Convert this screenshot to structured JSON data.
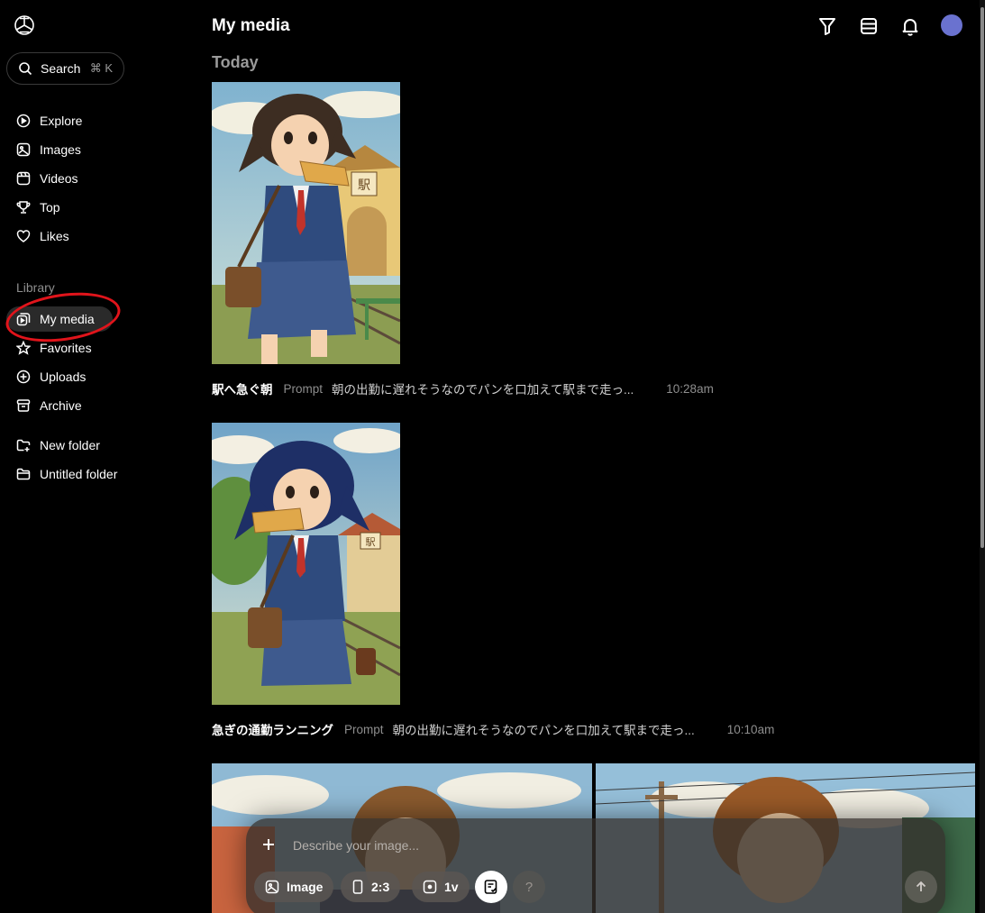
{
  "sidebar": {
    "search": {
      "label": "Search",
      "shortcut": "⌘ K"
    },
    "nav": [
      {
        "label": "Explore",
        "icon": "explore-icon"
      },
      {
        "label": "Images",
        "icon": "image-icon"
      },
      {
        "label": "Videos",
        "icon": "video-icon"
      },
      {
        "label": "Top",
        "icon": "trophy-icon"
      },
      {
        "label": "Likes",
        "icon": "heart-icon"
      }
    ],
    "library_label": "Library",
    "library": [
      {
        "label": "My media",
        "icon": "my-media-icon",
        "active": true
      },
      {
        "label": "Favorites",
        "icon": "star-icon"
      },
      {
        "label": "Uploads",
        "icon": "upload-icon"
      },
      {
        "label": "Archive",
        "icon": "archive-icon"
      }
    ],
    "folders": [
      {
        "label": "New folder",
        "icon": "new-folder-icon"
      },
      {
        "label": "Untitled folder",
        "icon": "folder-icon"
      }
    ]
  },
  "header": {
    "title": "My media",
    "icons": [
      "filter-icon",
      "list-view-icon",
      "bell-icon"
    ],
    "avatar_color": "#6a72cf"
  },
  "feed": {
    "day": "Today",
    "items": [
      {
        "title": "駅へ急ぐ朝",
        "prompt_label": "Prompt",
        "prompt": "朝の出勤に遅れそうなのでパンを口加えて駅まで走っ...",
        "time": "10:28am"
      },
      {
        "title": "急ぎの通勤ランニング",
        "prompt_label": "Prompt",
        "prompt": "朝の出勤に遅れそうなのでパンを口加えて駅まで走っ...",
        "time": "10:10am"
      }
    ]
  },
  "composer": {
    "placeholder": "Describe your image...",
    "type_label": "Image",
    "ratio_label": "2:3",
    "variations_label": "1v",
    "help_label": "?"
  },
  "colors": {
    "accent_circle": "#e0141b",
    "background": "#000000"
  }
}
